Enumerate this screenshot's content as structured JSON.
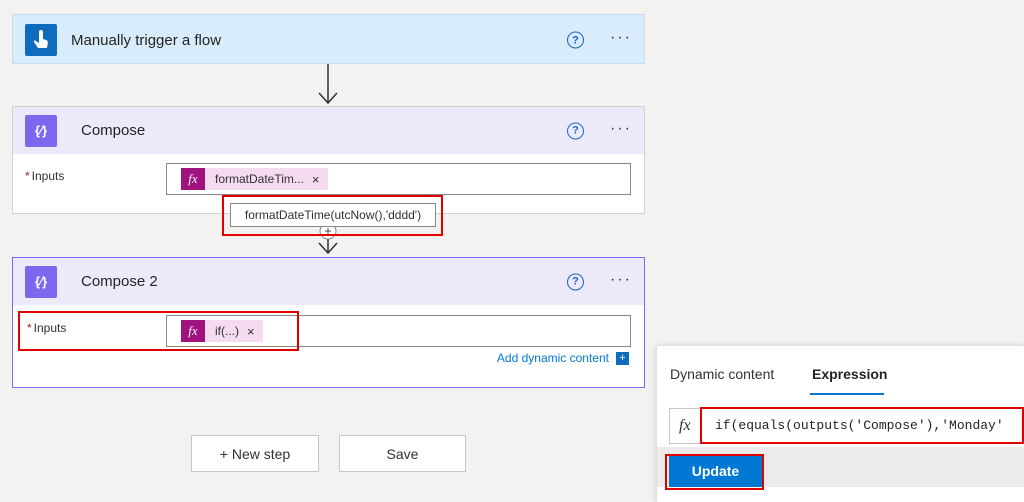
{
  "trigger": {
    "title": "Manually trigger a flow",
    "help": "?",
    "more": "···"
  },
  "compose": {
    "title": "Compose",
    "help": "?",
    "more": "···",
    "inputs_label": "Inputs",
    "required_mark": "*",
    "token_label": "formatDateTim...",
    "token_remove": "×",
    "fx": "fx",
    "tooltip": "formatDateTime(utcNow(),'dddd')"
  },
  "compose2": {
    "title": "Compose 2",
    "help": "?",
    "more": "···",
    "inputs_label": "Inputs",
    "required_mark": "*",
    "token_label": "if(...)",
    "token_remove": "×",
    "fx": "fx",
    "add_dynamic": "Add dynamic content",
    "add_dynamic_icon": "+"
  },
  "actions": {
    "new_step": "+ New step",
    "save": "Save"
  },
  "panel": {
    "tabs": [
      {
        "label": "Dynamic content",
        "active": false
      },
      {
        "label": "Expression",
        "active": true
      }
    ],
    "fx": "fx",
    "expression": "if(equals(outputs('Compose'),'Monday'",
    "update": "Update"
  },
  "colors": {
    "trigger": "#0f6cbd",
    "compose": "#7b68ee",
    "accent": "#0078d4",
    "highlight": "#e00000"
  }
}
